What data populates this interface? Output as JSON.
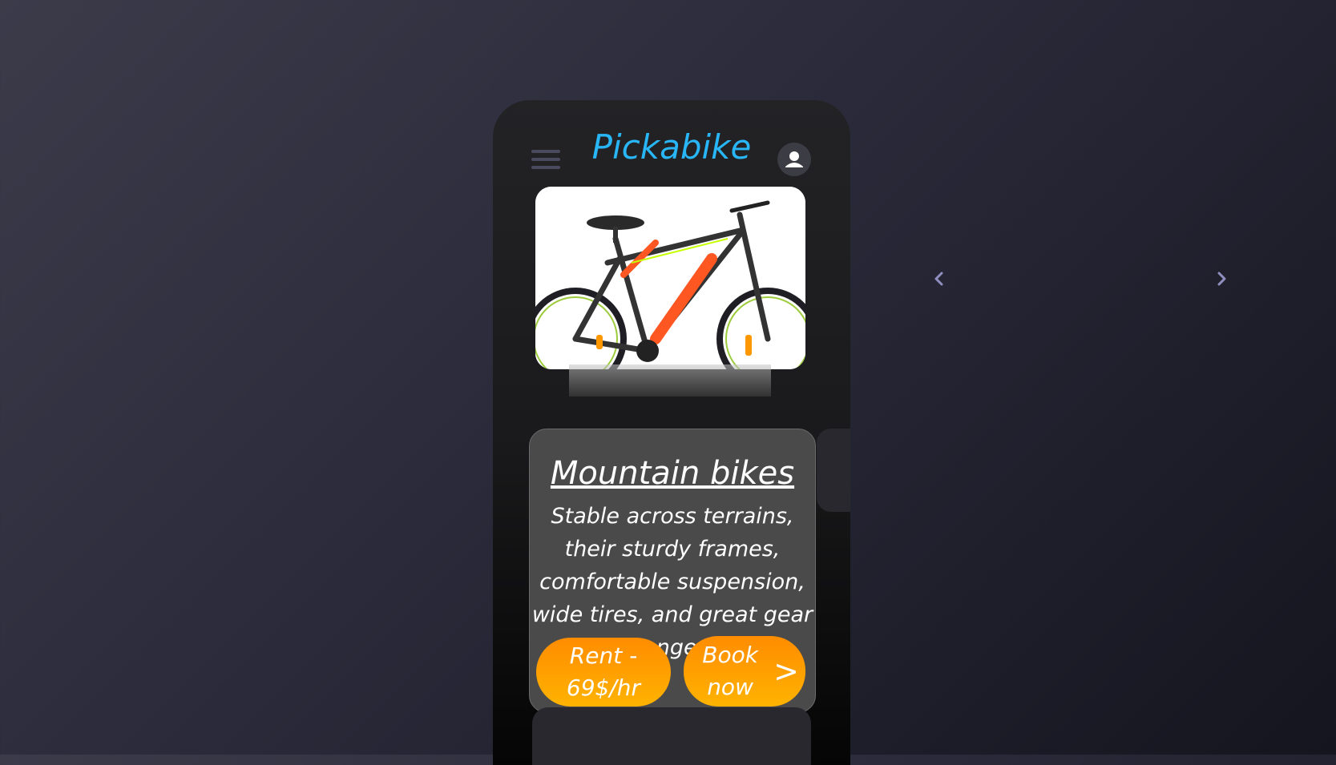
{
  "app": {
    "title": "Pickabike"
  },
  "header": {
    "menu_icon": "hamburger-menu-icon",
    "profile_icon": "user-avatar-icon"
  },
  "featured_image": {
    "description_icon": "mountain-bike-image"
  },
  "card": {
    "title": "Mountain bikes",
    "description": "Stable across terrains, their sturdy frames, comfortable suspension, wide tires, and great gear range .",
    "rent_label": "Rent - 69$/hr",
    "book_label": "Book now",
    "book_chevron": ">"
  },
  "carousel": {
    "prev_icon": "chevron-left-icon",
    "next_icon": "chevron-right-icon"
  },
  "colors": {
    "accent": "#29b6f6",
    "button": "#ff9800",
    "card_bg": "#4a4a4a"
  }
}
